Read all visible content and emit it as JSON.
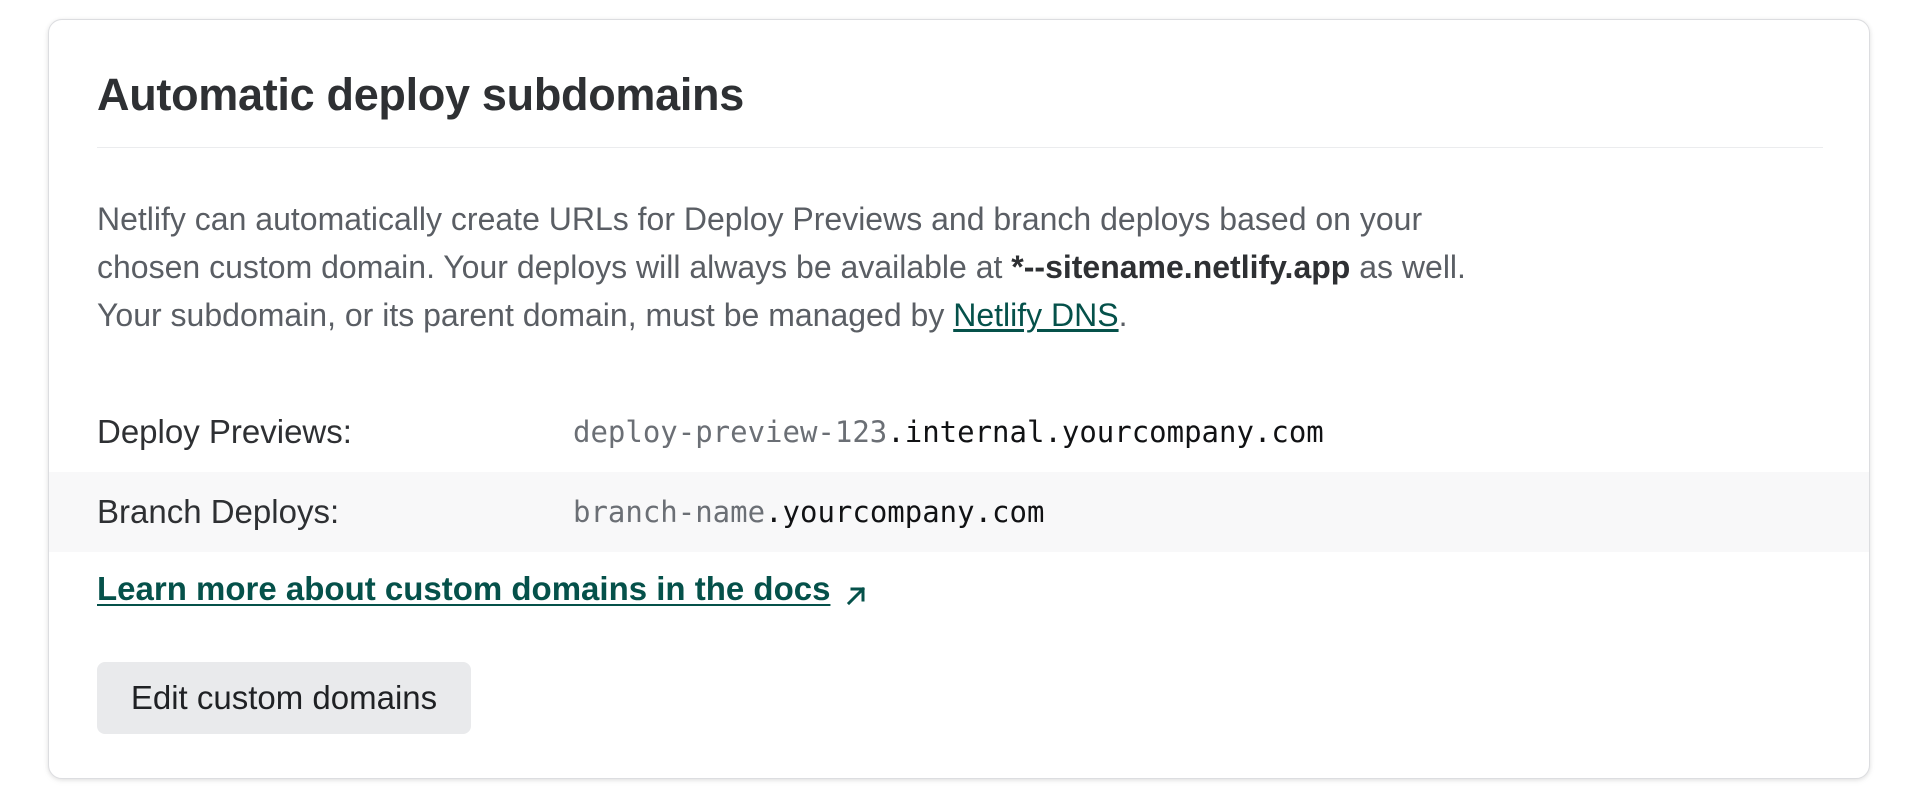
{
  "card": {
    "title": "Automatic deploy subdomains"
  },
  "description": {
    "part1": "Netlify can automatically create URLs for Deploy Previews and branch deploys based on your chosen custom domain. Your deploys will always be available at ",
    "bold_domain": "*--sitename.netlify.app",
    "part2": " as well. Your subdomain, or its parent domain, must be managed by ",
    "dns_link": "Netlify DNS",
    "part3": "."
  },
  "rows": [
    {
      "label": "Deploy Previews:",
      "prefix": "deploy-preview-123",
      "domain": ".internal.yourcompany.com"
    },
    {
      "label": "Branch Deploys:",
      "prefix": "branch-name",
      "domain": ".yourcompany.com"
    }
  ],
  "docs_link": {
    "label": "Learn more about custom domains in the docs",
    "icon": "external-arrow-icon"
  },
  "edit_button": {
    "label": "Edit custom domains"
  },
  "colors": {
    "link": "#05514a",
    "title": "#2e3033",
    "body_text": "#5a5e64",
    "button_bg": "#e9eaec",
    "row_alt_bg": "#f8f8f9"
  }
}
